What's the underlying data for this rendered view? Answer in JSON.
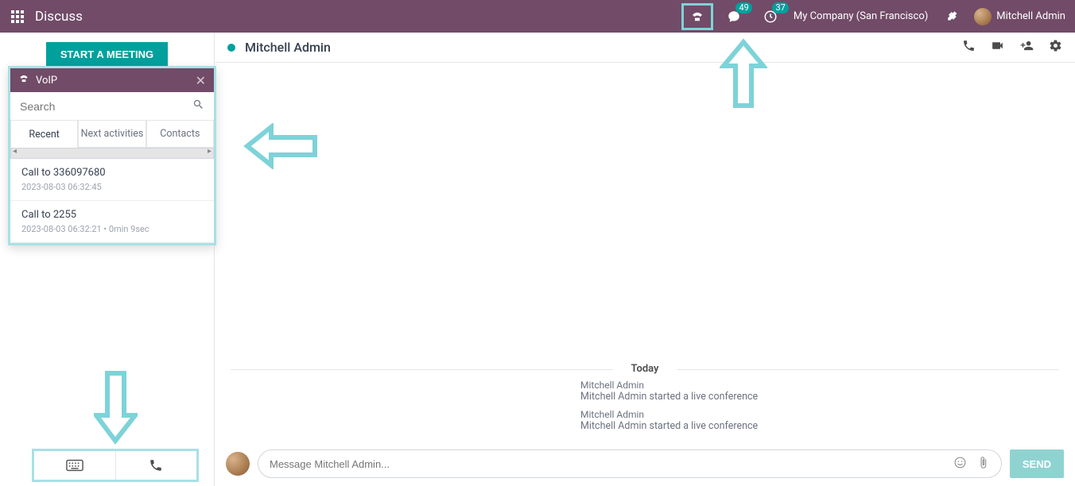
{
  "topbar": {
    "app_title": "Discuss",
    "messages_badge": "49",
    "activities_badge": "37",
    "company": "My Company (San Francisco)",
    "user": "Mitchell Admin"
  },
  "sidebar": {
    "start_meeting": "START A MEETING"
  },
  "chat": {
    "title": "Mitchell Admin",
    "date_separator": "Today",
    "messages": [
      {
        "author": "Mitchell Admin",
        "text": "Mitchell Admin started a live conference"
      },
      {
        "author": "Mitchell Admin",
        "text": "Mitchell Admin started a live conference"
      }
    ],
    "compose_placeholder": "Message Mitchell Admin...",
    "send_label": "SEND"
  },
  "voip": {
    "title": "VoIP",
    "search_placeholder": "Search",
    "tabs": {
      "recent": "Recent",
      "next": "Next activities",
      "contacts": "Contacts"
    },
    "items": [
      {
        "title": "Call to 336097680",
        "sub": "2023-08-03 06:32:45"
      },
      {
        "title": "Call to 2255",
        "sub": "2023-08-03 06:32:21 • 0min 9sec"
      }
    ]
  }
}
